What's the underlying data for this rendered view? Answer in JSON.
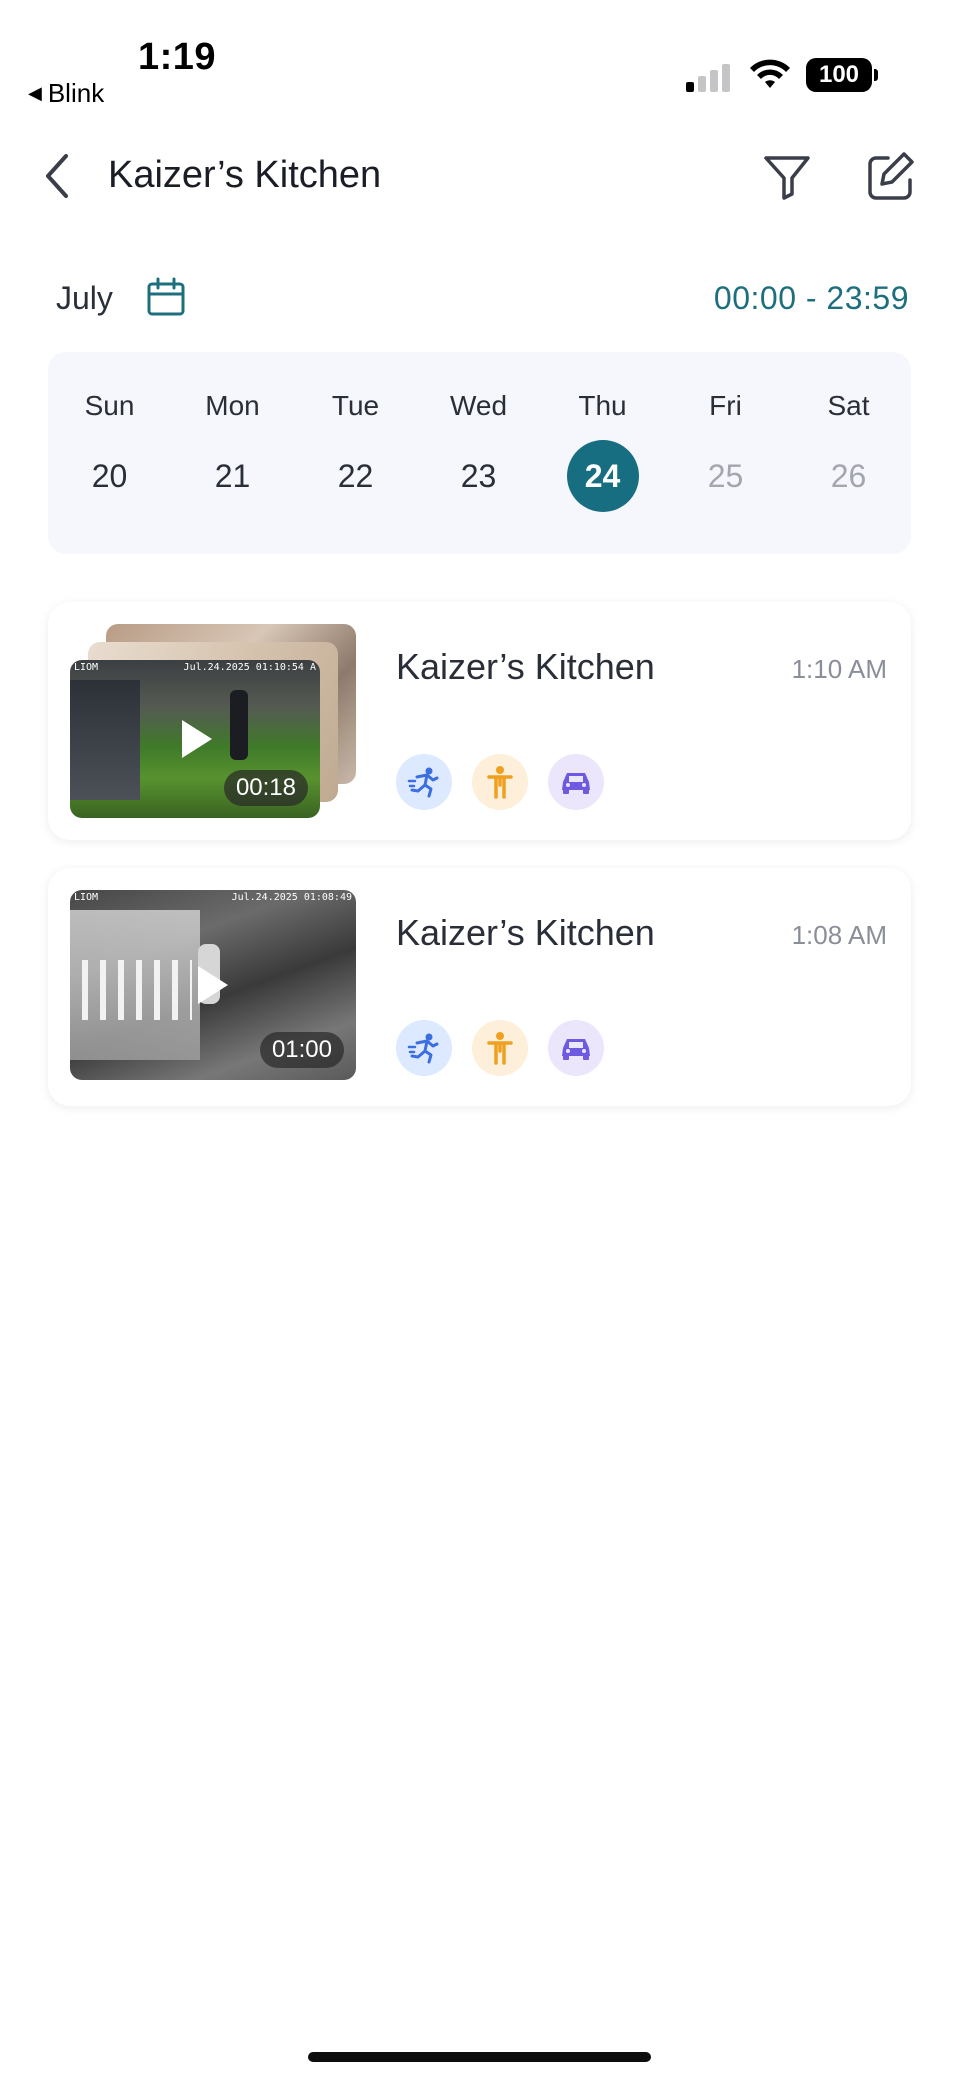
{
  "status_bar": {
    "time": "1:19",
    "back_app": "Blink",
    "back_arrow": "◀",
    "battery": "100"
  },
  "nav": {
    "title": "Kaizer’s Kitchen",
    "icons": [
      "chevron-left-icon",
      "filter-icon",
      "edit-icon"
    ]
  },
  "date_bar": {
    "month": "July",
    "time_range": "00:00 - 23:59"
  },
  "week": {
    "days": [
      {
        "name": "Sun",
        "date": "20"
      },
      {
        "name": "Mon",
        "date": "21"
      },
      {
        "name": "Tue",
        "date": "22"
      },
      {
        "name": "Wed",
        "date": "23"
      },
      {
        "name": "Thu",
        "date": "24",
        "selected": true
      },
      {
        "name": "Fri",
        "date": "25",
        "future": true
      },
      {
        "name": "Sat",
        "date": "26",
        "future": true
      }
    ]
  },
  "events": [
    {
      "camera": "Kaizer’s Kitchen",
      "time": "1:10 AM",
      "duration": "00:18",
      "osd_left": "LIOM",
      "osd_right": "Jul.24.2025 01:10:54 A",
      "detections": [
        "motion",
        "human",
        "vehicle"
      ]
    },
    {
      "camera": "Kaizer’s Kitchen",
      "time": "1:08 AM",
      "duration": "01:00",
      "osd_left": "LIOM",
      "osd_right": "Jul.24.2025 01:08:49",
      "detections": [
        "motion",
        "human",
        "vehicle"
      ]
    }
  ],
  "colors": {
    "accent": "#176e80",
    "time_range": "#1e6f7e",
    "motion": "#3b6fe0",
    "human": "#f0a020",
    "vehicle": "#6d5ae0"
  }
}
